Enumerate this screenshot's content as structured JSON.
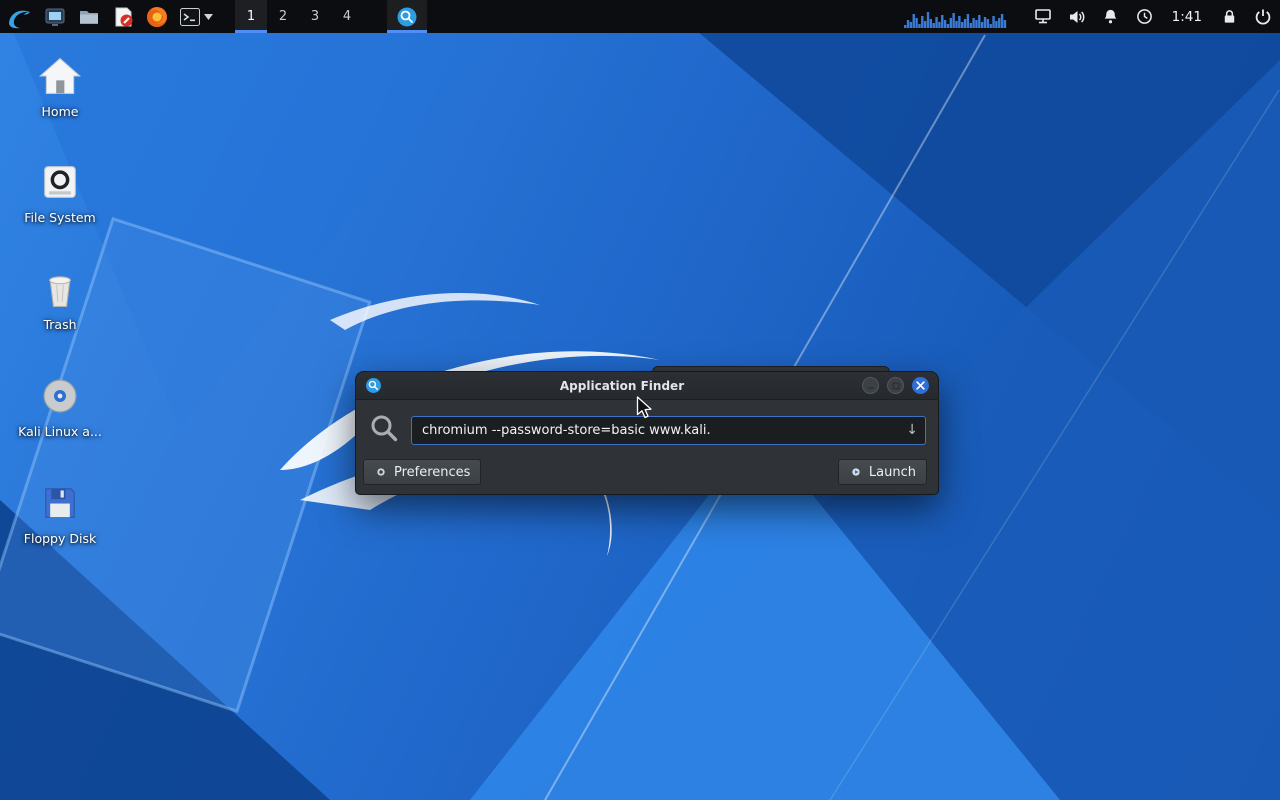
{
  "colors": {
    "accent_blue": "#4f8ef7",
    "panel_bg": "#0b0d10",
    "dialog_bg": "#2f3338",
    "input_border": "#3f71c8",
    "close_button": "#2e6fd8",
    "graph_bar": "#3a7bd5"
  },
  "panel": {
    "workspaces": [
      "1",
      "2",
      "3",
      "4"
    ],
    "clock": "1:41",
    "cpu_graph": {
      "bars": [
        0.15,
        0.4,
        0.3,
        0.7,
        0.5,
        0.2,
        0.6,
        0.35,
        0.8,
        0.45,
        0.25,
        0.55,
        0.3,
        0.65,
        0.4,
        0.2,
        0.5,
        0.75,
        0.35,
        0.6,
        0.3,
        0.45,
        0.7,
        0.25,
        0.5,
        0.4,
        0.65,
        0.3,
        0.55,
        0.45,
        0.2,
        0.6,
        0.35,
        0.5,
        0.7,
        0.4
      ]
    }
  },
  "desktop": {
    "icons": [
      {
        "label": "Home"
      },
      {
        "label": "File System"
      },
      {
        "label": "Trash"
      },
      {
        "label": "Kali Linux a..."
      },
      {
        "label": "Floppy Disk"
      }
    ]
  },
  "finder": {
    "title": "Application Finder",
    "search_value": "chromium --password-store=basic www.kali.",
    "dropdown_glyph": "↓",
    "preferences_label": "Preferences",
    "launch_label": "Launch"
  }
}
